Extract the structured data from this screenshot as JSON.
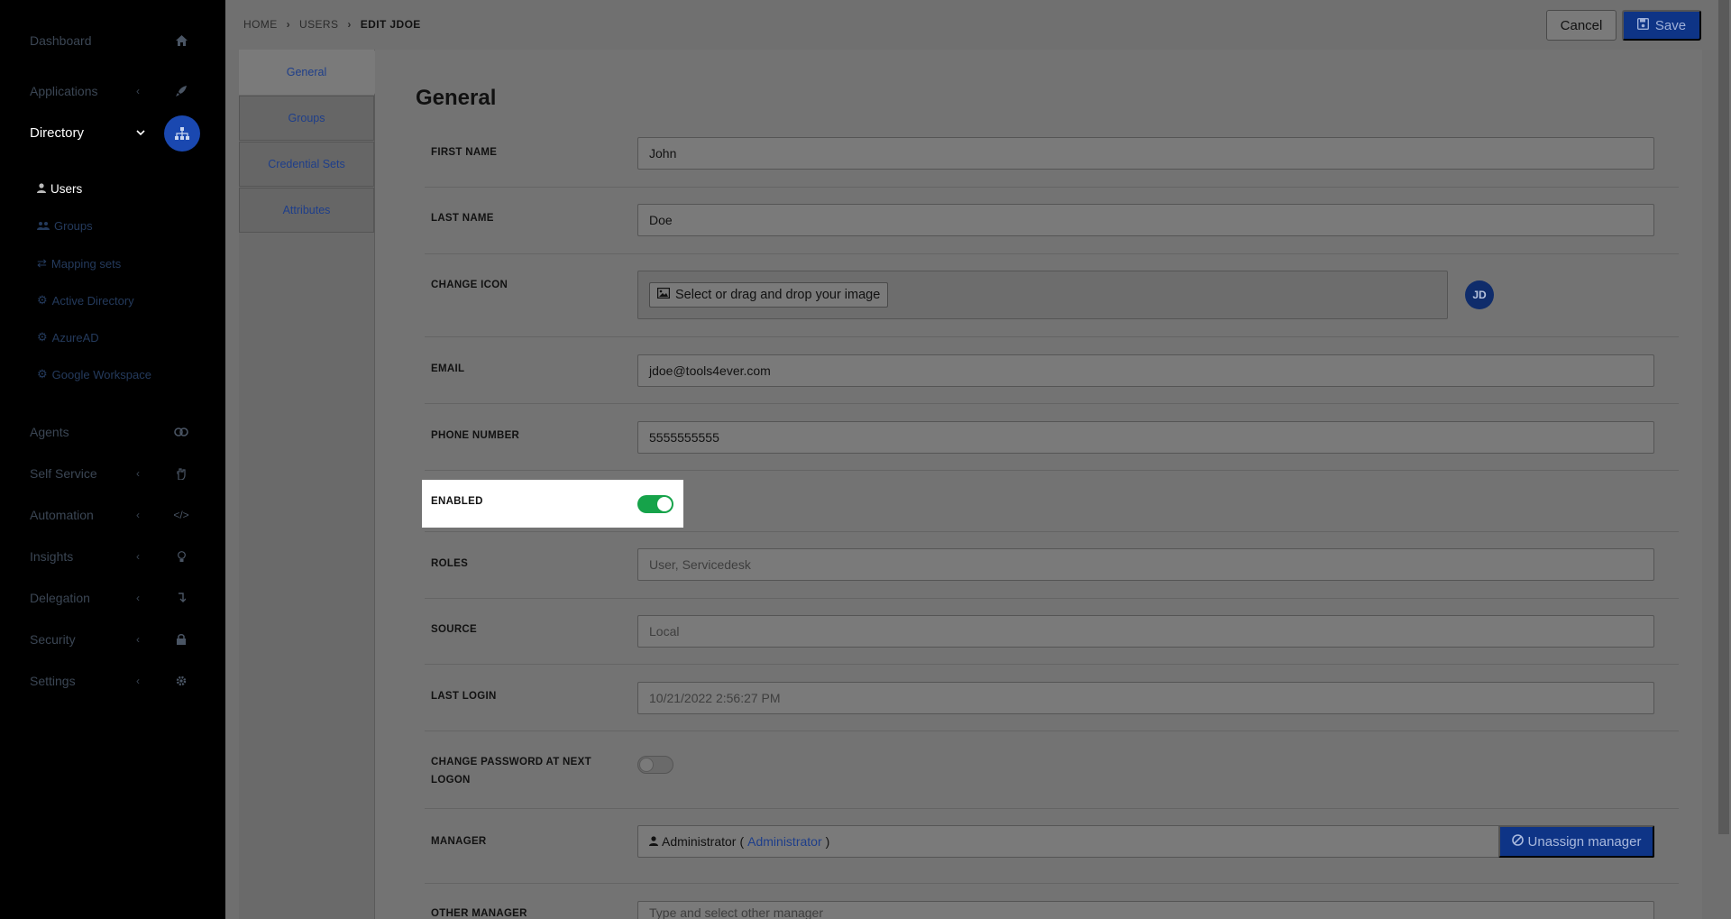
{
  "sidebar": {
    "items": [
      {
        "label": "Dashboard",
        "icon": "home-icon",
        "has_chevron": false
      },
      {
        "label": "Applications",
        "icon": "rocket-icon",
        "has_chevron": true
      },
      {
        "label": "Directory",
        "icon": "sitemap-icon",
        "has_chevron": true,
        "active": true
      },
      {
        "label": "Agents",
        "icon": "agents-icon",
        "has_chevron": false
      },
      {
        "label": "Self Service",
        "icon": "hand-icon",
        "has_chevron": true
      },
      {
        "label": "Automation",
        "icon": "code-icon",
        "has_chevron": true
      },
      {
        "label": "Insights",
        "icon": "lightbulb-icon",
        "has_chevron": true
      },
      {
        "label": "Delegation",
        "icon": "delegation-icon",
        "has_chevron": true
      },
      {
        "label": "Security",
        "icon": "lock-icon",
        "has_chevron": true
      },
      {
        "label": "Settings",
        "icon": "gear-icon",
        "has_chevron": true
      }
    ],
    "sub_items": [
      {
        "label": "Users",
        "icon": "user-icon",
        "active": true
      },
      {
        "label": "Groups",
        "icon": "users-icon"
      },
      {
        "label": "Mapping sets",
        "icon": "exchange-icon"
      },
      {
        "label": "Active Directory",
        "icon": "gear-icon"
      },
      {
        "label": "AzureAD",
        "icon": "gear-icon"
      },
      {
        "label": "Google Workspace",
        "icon": "gear-icon"
      }
    ]
  },
  "breadcrumb": {
    "home": "HOME",
    "users": "USERS",
    "current": "EDIT JDOE"
  },
  "toolbar": {
    "cancel_label": "Cancel",
    "save_label": "Save"
  },
  "tabs": [
    "General",
    "Groups",
    "Credential Sets",
    "Attributes"
  ],
  "form": {
    "title": "General",
    "first_name": {
      "label": "FIRST NAME",
      "value": "John"
    },
    "last_name": {
      "label": "LAST NAME",
      "value": "Doe"
    },
    "change_icon": {
      "label": "CHANGE ICON",
      "button": "Select or drag and drop your image",
      "avatar_initials": "JD"
    },
    "email": {
      "label": "EMAIL",
      "value": "jdoe@tools4ever.com"
    },
    "phone": {
      "label": "PHONE NUMBER",
      "value": "5555555555"
    },
    "enabled": {
      "label": "ENABLED",
      "on": true
    },
    "roles": {
      "label": "ROLES",
      "value": "User, Servicedesk"
    },
    "source": {
      "label": "SOURCE",
      "value": "Local"
    },
    "last_login": {
      "label": "LAST LOGIN",
      "value": "10/21/2022 2:56:27 PM"
    },
    "change_password": {
      "label": "CHANGE PASSWORD AT NEXT LOGON",
      "on": false
    },
    "manager": {
      "label": "MANAGER",
      "name": "Administrator",
      "paren_open": "(",
      "link": "Administrator",
      "paren_close": ")",
      "unassign_label": "Unassign manager"
    },
    "other_manager": {
      "label": "OTHER MANAGER",
      "placeholder": "Type and select other manager"
    }
  },
  "colors": {
    "accent": "#0e3486",
    "toggle_on": "#16a34a",
    "sidebar_bg": "#000000"
  }
}
